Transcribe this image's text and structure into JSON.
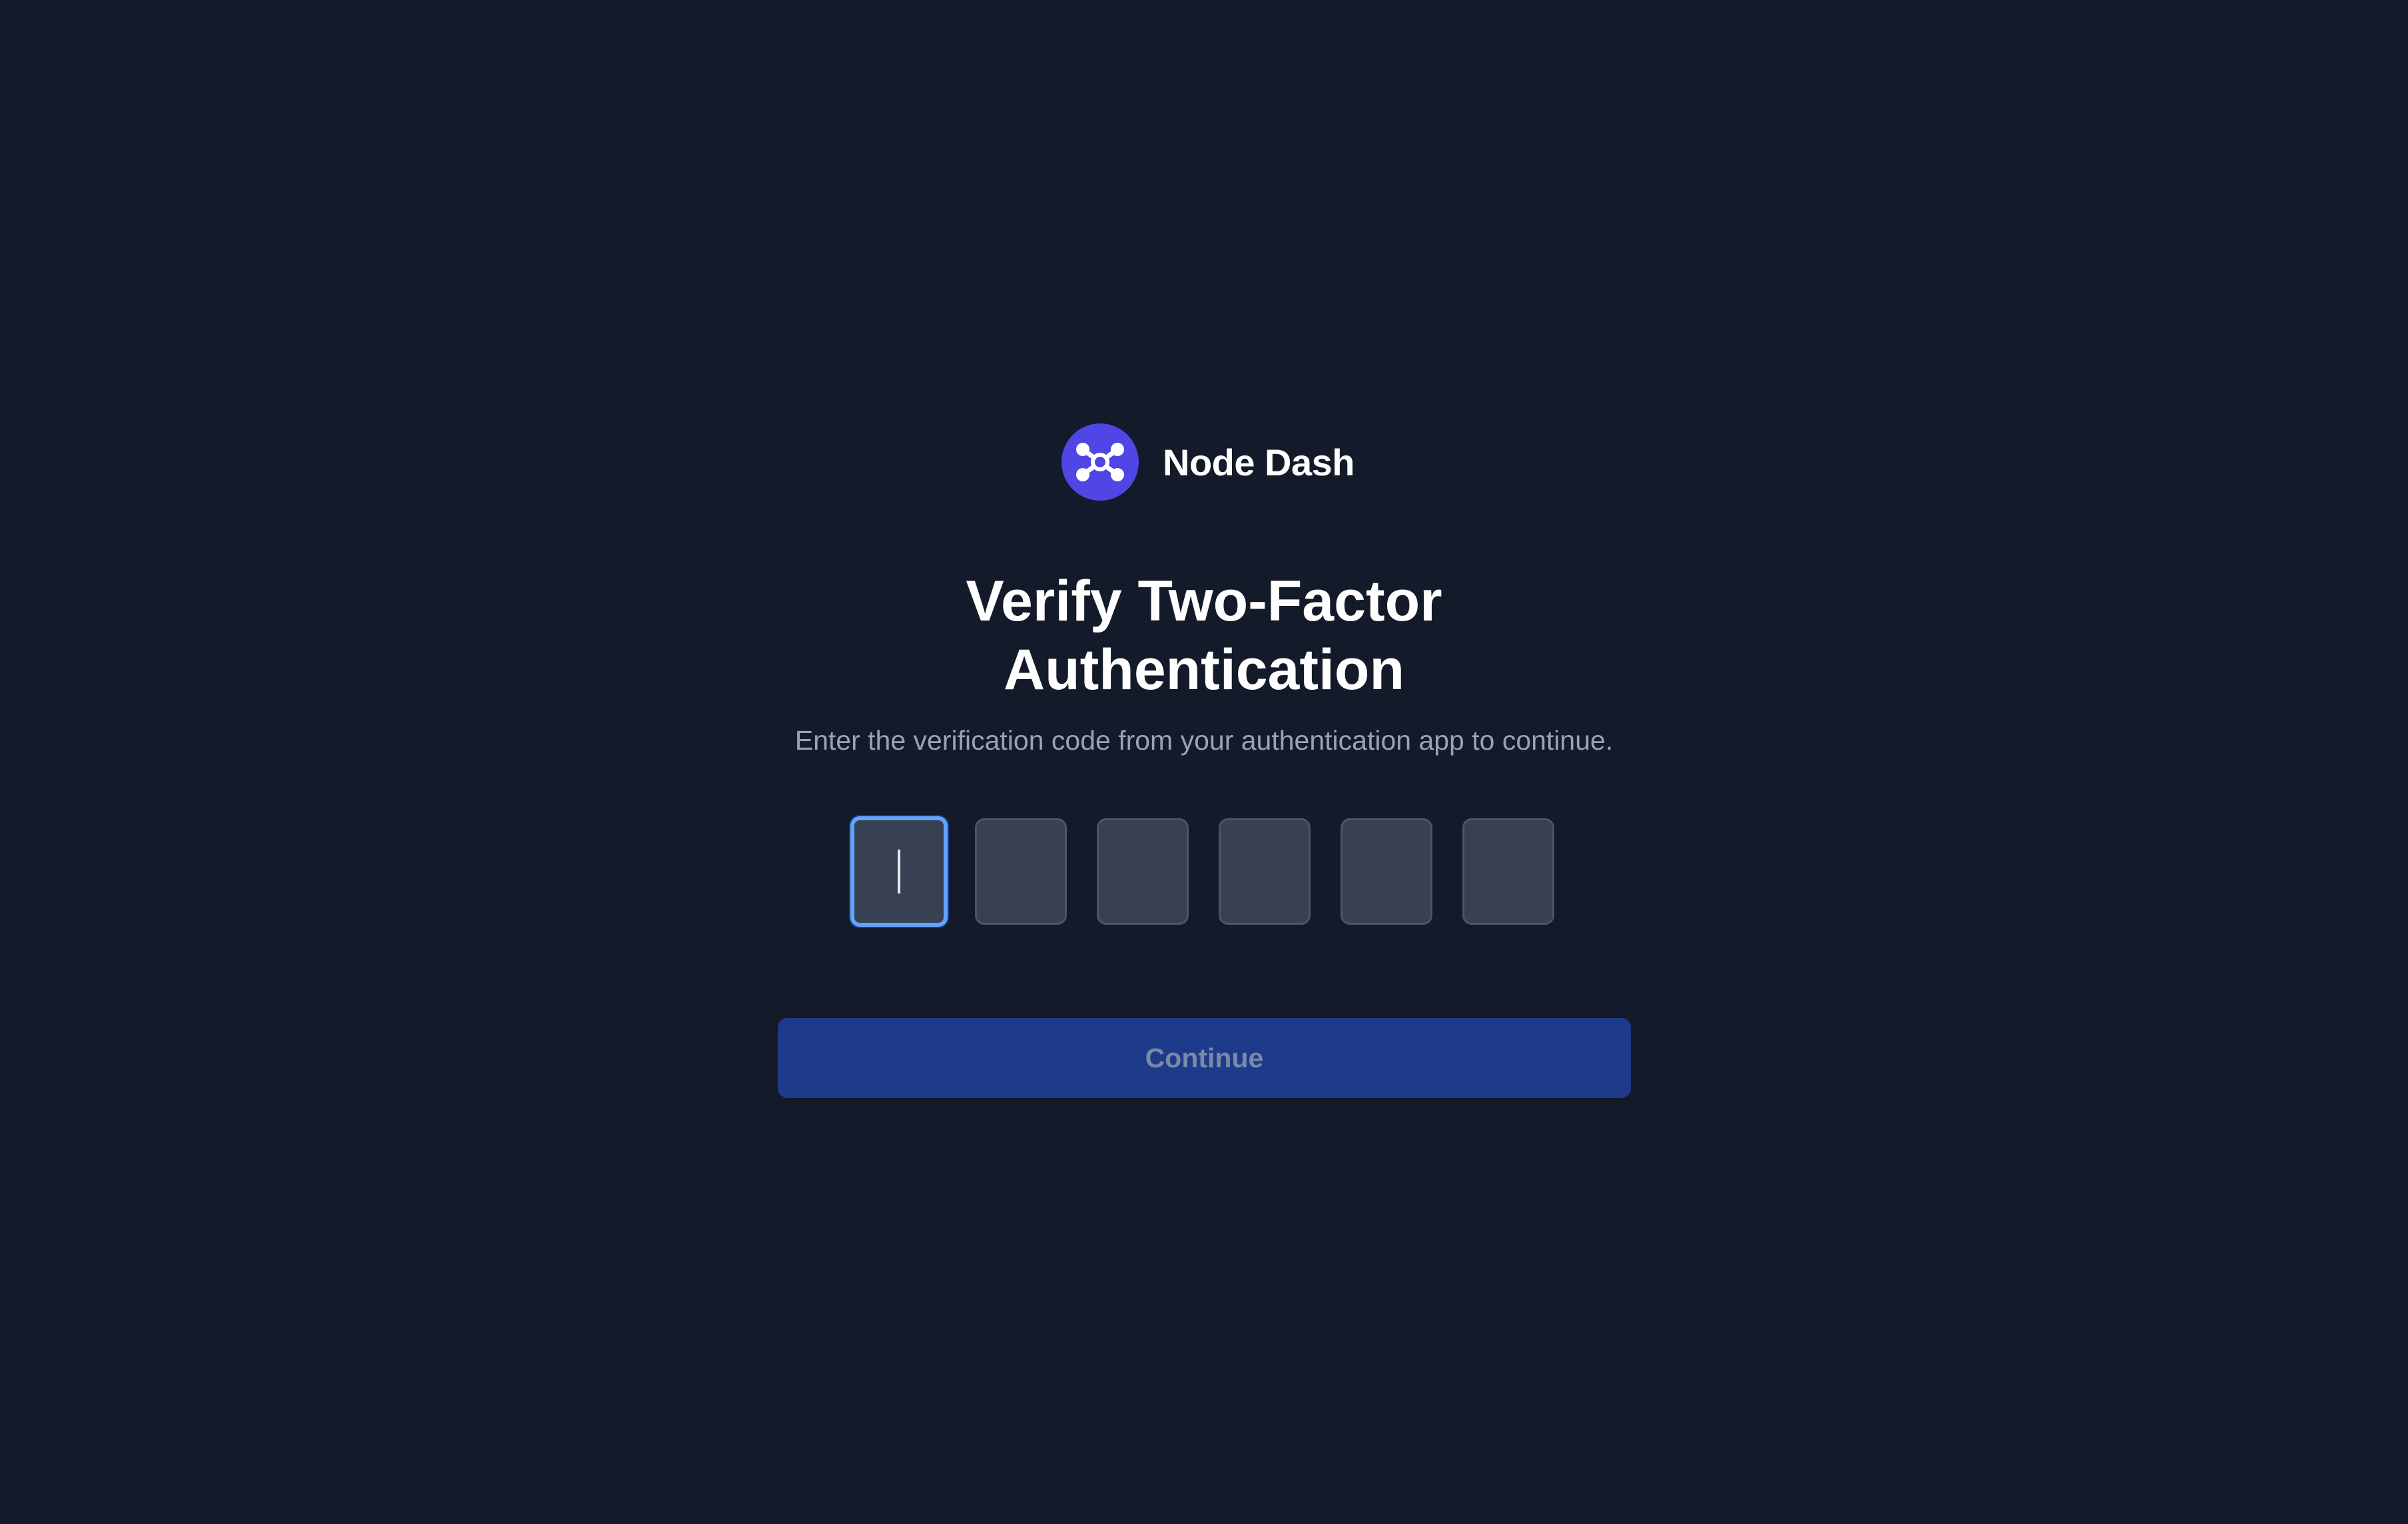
{
  "brand": {
    "name": "Node Dash",
    "logo_icon": "network-nodes-icon",
    "logo_color": "#4f46e5"
  },
  "page": {
    "title_line1": "Verify Two-Factor",
    "title_line2": "Authentication",
    "subtitle": "Enter the verification code from your authentication app to continue."
  },
  "otp": {
    "digits": [
      "",
      "",
      "",
      "",
      "",
      ""
    ],
    "active_index": 0,
    "active_border_color": "#60a5fa"
  },
  "actions": {
    "continue_label": "Continue",
    "continue_bg": "#1e3a8a"
  },
  "colors": {
    "background": "#131a29"
  }
}
